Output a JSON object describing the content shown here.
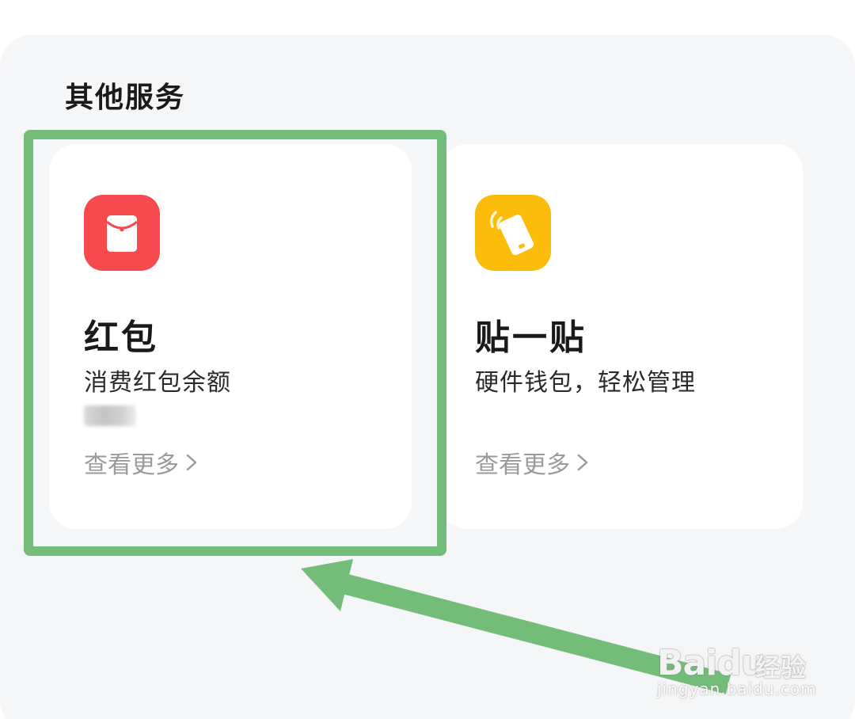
{
  "section": {
    "title": "其他服务"
  },
  "cards": [
    {
      "title": "红包",
      "description": "消费红包余额",
      "more_label": "查看更多",
      "icon": "red-envelope-icon",
      "icon_color": "#f64a4f"
    },
    {
      "title": "贴一贴",
      "description": "硬件钱包，轻松管理",
      "more_label": "查看更多",
      "icon": "tap-phone-icon",
      "icon_color": "#fcbc0c"
    }
  ],
  "annotation": {
    "highlight_color": "#74bd78"
  },
  "watermark": {
    "logo": "Baidu",
    "label": "经验",
    "url": "jingyan.baidu.com"
  }
}
